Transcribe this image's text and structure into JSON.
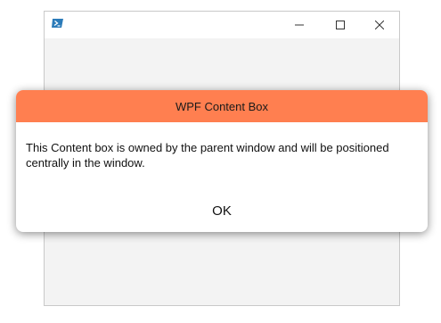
{
  "parent_window": {
    "icon": "powershell-icon",
    "caption_buttons": {
      "minimize_icon": "minimize-icon",
      "maximize_icon": "maximize-icon",
      "close_icon": "close-icon"
    },
    "background_color": "#f3f3f3"
  },
  "content_box": {
    "title": "WPF Content Box",
    "message": "This Content box is owned by the parent window and will be positioned centrally in the window.",
    "ok_label": "OK",
    "header_color": "#ff7f50"
  }
}
